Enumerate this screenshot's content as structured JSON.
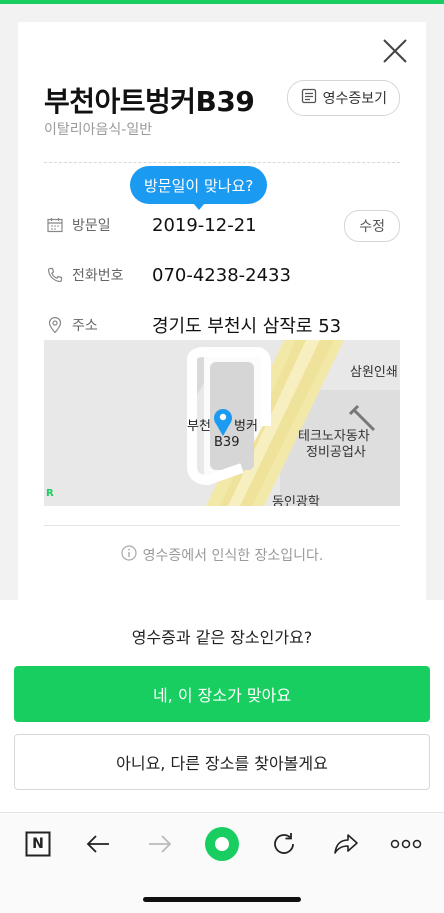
{
  "place": {
    "name": "부천아트벙커B39",
    "category": "이탈리아음식-일반",
    "receipt_button": "영수증보기"
  },
  "bubble": "방문일이 맞나요?",
  "details": {
    "visit": {
      "label": "방문일",
      "value": "2019-12-21",
      "edit": "수정"
    },
    "phone": {
      "label": "전화번호",
      "value": "070-4238-2433"
    },
    "address": {
      "label": "주소",
      "value": "경기도 부천시 삼작로 53"
    }
  },
  "map": {
    "pin_label_line1": "부천",
    "pin_label_line1b": "벙커",
    "pin_label_line2": "B39",
    "poi_1": "삼원인쇄",
    "poi_2_line1": "테크노자동차",
    "poi_2_line2": "정비공업사",
    "poi_3": "동인광학",
    "edge_label": "R"
  },
  "note": "영수증에서 인식한 장소입니다.",
  "sheet": {
    "question": "영수증과 같은 장소인가요?",
    "yes": "네, 이 장소가 맞아요",
    "no": "아니요, 다른 장소를 찾아볼게요"
  },
  "toolbar": {
    "home_letter": "N",
    "more": "ooo"
  },
  "colors": {
    "accent_green": "#19ce60",
    "bubble_blue": "#1a9af0",
    "pin_blue": "#1a9af0"
  }
}
